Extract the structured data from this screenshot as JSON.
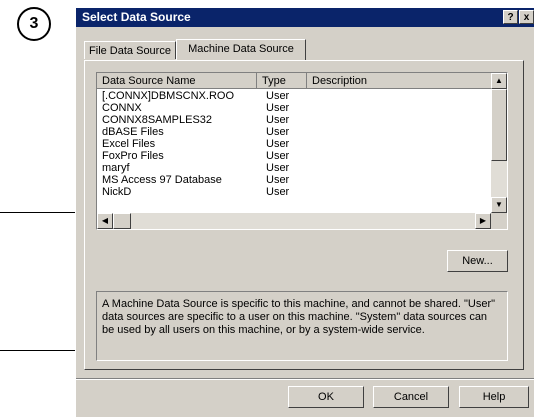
{
  "step_badge": "3",
  "window": {
    "title": "Select Data Source",
    "help_glyph": "?",
    "close_glyph": "x"
  },
  "tabs": [
    {
      "label": "File Data Source",
      "active": false
    },
    {
      "label": "Machine Data Source",
      "active": true
    }
  ],
  "list": {
    "columns": [
      "Data Source Name",
      "Type",
      "Description"
    ],
    "rows": [
      {
        "name": "[.CONNX]DBMSCNX.ROO",
        "type": "User"
      },
      {
        "name": "CONNX",
        "type": "User"
      },
      {
        "name": "CONNX8SAMPLES32",
        "type": "User"
      },
      {
        "name": "dBASE Files",
        "type": "User"
      },
      {
        "name": "Excel Files",
        "type": "User"
      },
      {
        "name": "FoxPro Files",
        "type": "User"
      },
      {
        "name": "maryf",
        "type": "User"
      },
      {
        "name": "MS Access 97 Database",
        "type": "User"
      },
      {
        "name": "NickD",
        "type": "User"
      }
    ]
  },
  "buttons": {
    "new": "New...",
    "ok": "OK",
    "cancel": "Cancel",
    "help": "Help"
  },
  "info_text": "A Machine Data Source is specific to this machine, and cannot be shared. \"User\" data sources are specific to a user on this machine.  \"System\" data sources can be used by all users on this machine, or by a system-wide service."
}
